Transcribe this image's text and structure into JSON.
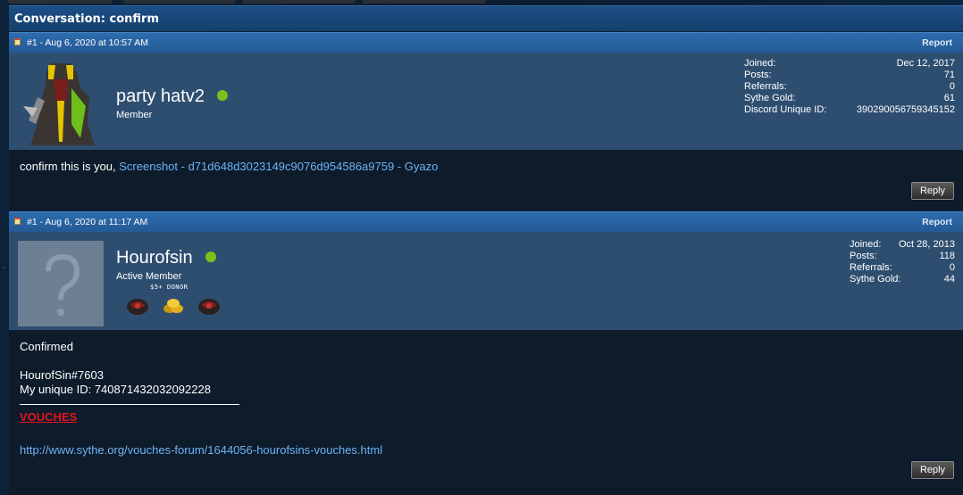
{
  "conversation": {
    "title": "Conversation: confirm"
  },
  "posts": [
    {
      "meta": "#1 - Aug 6, 2020 at 10:57 AM",
      "report": "Report",
      "username": "party hatv2",
      "user_title": "Member",
      "stats": [
        {
          "label": "Joined:",
          "value": "Dec 12, 2017"
        },
        {
          "label": "Posts:",
          "value": "71"
        },
        {
          "label": "Referrals:",
          "value": "0"
        },
        {
          "label": "Sythe Gold:",
          "value": "61"
        },
        {
          "label": "Discord Unique ID:",
          "value": "390290056759345152"
        }
      ],
      "body_text": "confirm this is you, ",
      "body_link": "Screenshot - d71d648d3023149c9076d954586a9759 - Gyazo",
      "reply": "Reply"
    },
    {
      "meta": "#1 - Aug 6, 2020 at 11:17 AM",
      "report": "Report",
      "username": "Hourofsin",
      "user_title": "Active Member",
      "donor_label": "$5+ DONOR",
      "stats": [
        {
          "label": "Joined:",
          "value": "Oct 28, 2013"
        },
        {
          "label": "Posts:",
          "value": "118"
        },
        {
          "label": "Referrals:",
          "value": "0"
        },
        {
          "label": "Sythe Gold:",
          "value": "44"
        }
      ],
      "body_lines": [
        "Confirmed",
        "HourofSin#7603",
        "My unique ID: 740871432032092228"
      ],
      "vouches": "VOUCHES",
      "vouch_link": "http://www.sythe.org/vouches-forum/1644056-hourofsins-vouches.html",
      "reply": "Reply"
    }
  ],
  "colors": {
    "online": "#7cc01c",
    "link": "#6fb3f5",
    "vouches": "#e4141b",
    "header": "#245a95"
  }
}
